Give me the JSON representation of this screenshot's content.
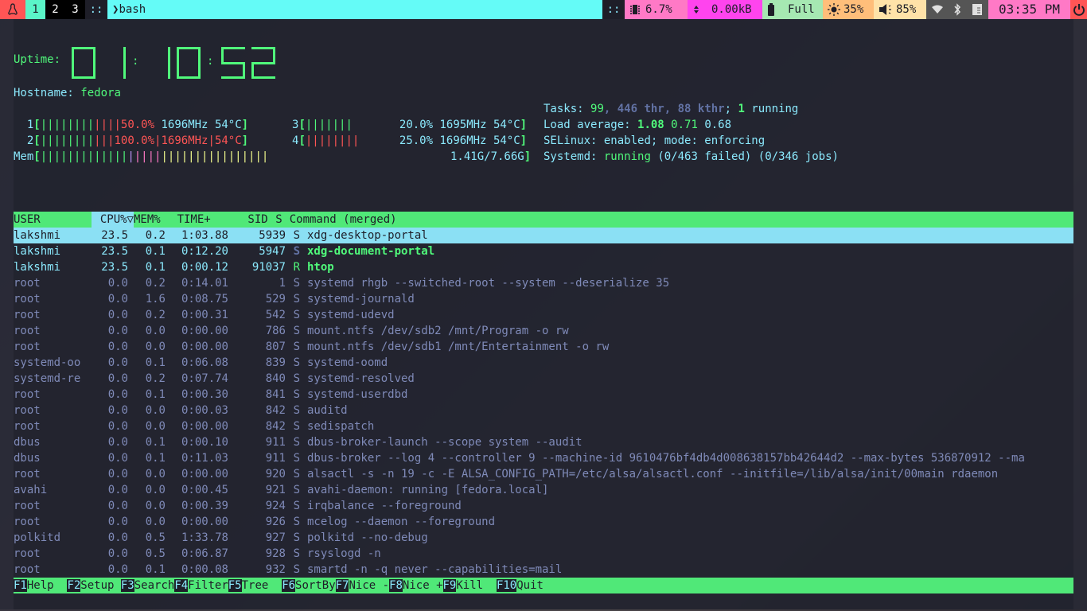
{
  "topbar": {
    "logo_icon": "fedora-penguin-icon",
    "workspaces": [
      {
        "label": "1",
        "active": true
      },
      {
        "label": "2",
        "active": false
      },
      {
        "label": "3",
        "active": false
      }
    ],
    "separator": "::",
    "window_title_prefix": "❯",
    "window_title": "bash",
    "cpu": "6.7%",
    "network": "0.00kB",
    "battery": "Full",
    "brightness": "35%",
    "volume": "85%",
    "clock": "03:35 PM",
    "colors": {
      "logo": "#ff5555",
      "workspace_active": "#5af5c8",
      "title": "#64fbf7",
      "cpu": "#ff79c6",
      "network": "#ff44ee",
      "battery": "#a6e8b2",
      "brightness": "#ffbe7a",
      "volume": "#ffe2a8",
      "clock": "#ff79c6",
      "power": "#ff5555"
    }
  },
  "htop": {
    "uptime_label": "Uptime:",
    "uptime": "01:10:52",
    "hostname_label": "Hostname:",
    "hostname": "fedora",
    "cpus": [
      {
        "id": "1",
        "percent": 50.0,
        "percent_label": "50.0%",
        "freq": "1696MHz",
        "temp": "54°C"
      },
      {
        "id": "2",
        "percent": 100.0,
        "percent_label": "100.0%",
        "freq": "1696MHz",
        "temp": "54°C"
      },
      {
        "id": "3",
        "percent": 20.0,
        "percent_label": "20.0%",
        "freq": "1695MHz",
        "temp": "54°C"
      },
      {
        "id": "4",
        "percent": 25.0,
        "percent_label": "25.0%",
        "freq": "1696MHz",
        "temp": "54°C"
      }
    ],
    "mem": {
      "label": "Mem",
      "used": "1.41G",
      "total": "7.66G",
      "text": "1.41G/7.66G"
    },
    "tasks": {
      "label": "Tasks:",
      "count": "99",
      "threads": "446 thr",
      "kthreads": "88 kthr",
      "running": "1",
      "running_label": "running"
    },
    "load": {
      "label": "Load average:",
      "one": "1.08",
      "five": "0.71",
      "fifteen": "0.68"
    },
    "selinux": {
      "label": "SELinux:",
      "text": "enabled; mode: enforcing"
    },
    "systemd": {
      "label": "Systemd:",
      "state": "running",
      "failed": "(0/463 failed)",
      "jobs": "(0/346 jobs)"
    }
  },
  "table": {
    "headers": {
      "user": "USER",
      "cpu": "CPU%▽",
      "mem": "MEM%",
      "time": "TIME+",
      "sid": "SID",
      "s": "S",
      "cmd": "Command (merged)"
    },
    "rows": [
      {
        "user": "lakshmi",
        "cpu": "23.5",
        "mem": "0.2",
        "time": "1:03.88",
        "sid": "5939",
        "s": "S",
        "cmd": "xdg-desktop-portal"
      },
      {
        "user": "lakshmi",
        "cpu": "23.5",
        "mem": "0.1",
        "time": "0:12.20",
        "sid": "5947",
        "s": "S",
        "cmd": "xdg-document-portal"
      },
      {
        "user": "lakshmi",
        "cpu": "23.5",
        "mem": "0.1",
        "time": "0:00.12",
        "sid": "91037",
        "s": "R",
        "cmd": "htop"
      },
      {
        "user": "root",
        "cpu": "0.0",
        "mem": "0.2",
        "time": "0:14.01",
        "sid": "1",
        "s": "S",
        "cmd": "systemd rhgb --switched-root --system --deserialize 35"
      },
      {
        "user": "root",
        "cpu": "0.0",
        "mem": "1.6",
        "time": "0:08.75",
        "sid": "529",
        "s": "S",
        "cmd": "systemd-journald"
      },
      {
        "user": "root",
        "cpu": "0.0",
        "mem": "0.2",
        "time": "0:00.31",
        "sid": "542",
        "s": "S",
        "cmd": "systemd-udevd"
      },
      {
        "user": "root",
        "cpu": "0.0",
        "mem": "0.0",
        "time": "0:00.00",
        "sid": "786",
        "s": "S",
        "cmd": "mount.ntfs /dev/sdb2 /mnt/Program -o rw"
      },
      {
        "user": "root",
        "cpu": "0.0",
        "mem": "0.0",
        "time": "0:00.00",
        "sid": "807",
        "s": "S",
        "cmd": "mount.ntfs /dev/sdb1 /mnt/Entertainment -o rw"
      },
      {
        "user": "systemd-oo",
        "cpu": "0.0",
        "mem": "0.1",
        "time": "0:06.08",
        "sid": "839",
        "s": "S",
        "cmd": "systemd-oomd"
      },
      {
        "user": "systemd-re",
        "cpu": "0.0",
        "mem": "0.2",
        "time": "0:07.74",
        "sid": "840",
        "s": "S",
        "cmd": "systemd-resolved"
      },
      {
        "user": "root",
        "cpu": "0.0",
        "mem": "0.1",
        "time": "0:00.30",
        "sid": "841",
        "s": "S",
        "cmd": "systemd-userdbd"
      },
      {
        "user": "root",
        "cpu": "0.0",
        "mem": "0.0",
        "time": "0:00.03",
        "sid": "842",
        "s": "S",
        "cmd": "auditd"
      },
      {
        "user": "root",
        "cpu": "0.0",
        "mem": "0.0",
        "time": "0:00.00",
        "sid": "842",
        "s": "S",
        "cmd": "sedispatch"
      },
      {
        "user": "dbus",
        "cpu": "0.0",
        "mem": "0.1",
        "time": "0:00.10",
        "sid": "911",
        "s": "S",
        "cmd": "dbus-broker-launch --scope system --audit"
      },
      {
        "user": "dbus",
        "cpu": "0.0",
        "mem": "0.1",
        "time": "0:11.03",
        "sid": "911",
        "s": "S",
        "cmd": "dbus-broker --log 4 --controller 9 --machine-id 9610476bf4db4d008638157bb42644d2 --max-bytes 536870912 --ma"
      },
      {
        "user": "root",
        "cpu": "0.0",
        "mem": "0.0",
        "time": "0:00.00",
        "sid": "920",
        "s": "S",
        "cmd": "alsactl -s -n 19 -c -E ALSA_CONFIG_PATH=/etc/alsa/alsactl.conf --initfile=/lib/alsa/init/00main rdaemon"
      },
      {
        "user": "avahi",
        "cpu": "0.0",
        "mem": "0.0",
        "time": "0:00.45",
        "sid": "921",
        "s": "S",
        "cmd": "avahi-daemon: running [fedora.local]"
      },
      {
        "user": "root",
        "cpu": "0.0",
        "mem": "0.0",
        "time": "0:00.39",
        "sid": "924",
        "s": "S",
        "cmd": "irqbalance --foreground"
      },
      {
        "user": "root",
        "cpu": "0.0",
        "mem": "0.0",
        "time": "0:00.00",
        "sid": "926",
        "s": "S",
        "cmd": "mcelog --daemon --foreground"
      },
      {
        "user": "polkitd",
        "cpu": "0.0",
        "mem": "0.5",
        "time": "1:33.78",
        "sid": "927",
        "s": "S",
        "cmd": "polkitd --no-debug"
      },
      {
        "user": "root",
        "cpu": "0.0",
        "mem": "0.5",
        "time": "0:06.87",
        "sid": "928",
        "s": "S",
        "cmd": "rsyslogd -n"
      },
      {
        "user": "root",
        "cpu": "0.0",
        "mem": "0.1",
        "time": "0:00.08",
        "sid": "932",
        "s": "S",
        "cmd": "smartd -n -q never --capabilities=mail"
      }
    ]
  },
  "fkeys": [
    {
      "key": "F1",
      "label": "Help  "
    },
    {
      "key": "F2",
      "label": "Setup "
    },
    {
      "key": "F3",
      "label": "Search"
    },
    {
      "key": "F4",
      "label": "Filter"
    },
    {
      "key": "F5",
      "label": "Tree  "
    },
    {
      "key": "F6",
      "label": "SortBy"
    },
    {
      "key": "F7",
      "label": "Nice -"
    },
    {
      "key": "F8",
      "label": "Nice +"
    },
    {
      "key": "F9",
      "label": "Kill  "
    },
    {
      "key": "F10",
      "label": "Quit"
    }
  ]
}
